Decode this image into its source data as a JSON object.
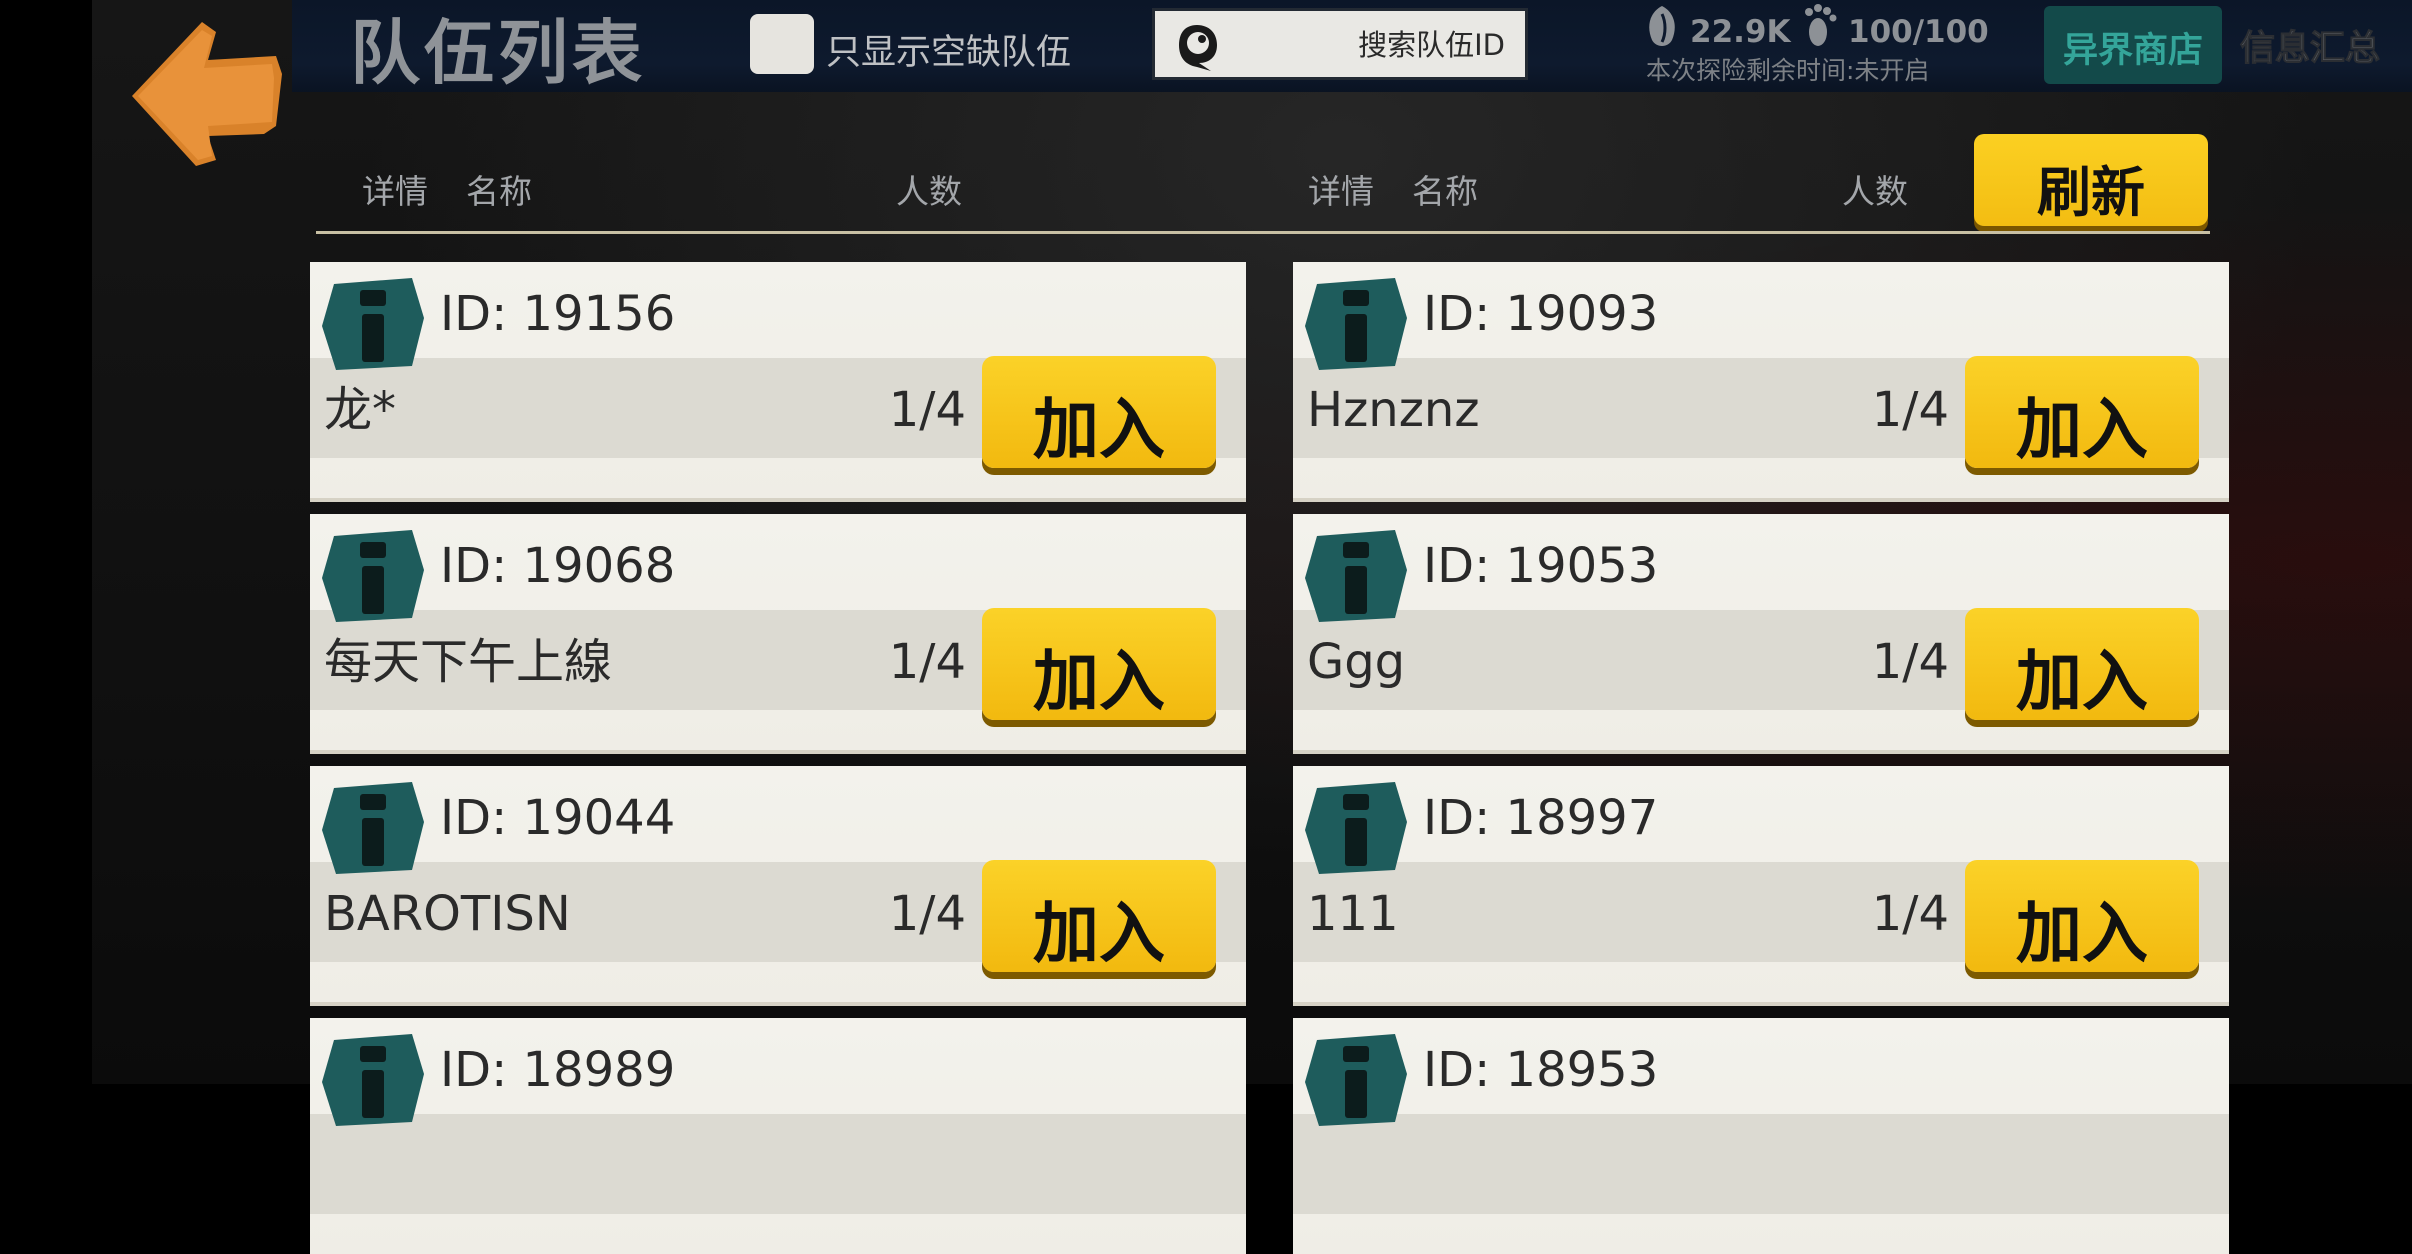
{
  "header": {
    "title": "队伍列表",
    "empty_only_label": "只显示空缺队伍",
    "search_placeholder": "搜索队伍ID",
    "coins": "22.9K",
    "stamina": "100/100",
    "timer": "本次探险剩余时间:未开启",
    "shop_label": "异界商店",
    "info_label": "信息汇总"
  },
  "columns": {
    "left": {
      "details": "详情",
      "name": "名称",
      "count": "人数"
    },
    "right": {
      "details": "详情",
      "name": "名称",
      "count": "人数"
    },
    "refresh_label": "刷新"
  },
  "join_label": "加入",
  "teams": [
    {
      "id": "ID:  19156",
      "name": "龙*",
      "count": "1/4"
    },
    {
      "id": "ID:  19093",
      "name": "Hznznz",
      "count": "1/4"
    },
    {
      "id": "ID:  19068",
      "name": "每天下午上線",
      "count": "1/4"
    },
    {
      "id": "ID:  19053",
      "name": "Ggg",
      "count": "1/4"
    },
    {
      "id": "ID:  19044",
      "name": "BAROTISN",
      "count": "1/4"
    },
    {
      "id": "ID:  18997",
      "name": "111",
      "count": "1/4"
    },
    {
      "id": "ID:  18989",
      "name": "",
      "count": ""
    },
    {
      "id": "ID:  18953",
      "name": "",
      "count": ""
    }
  ],
  "colors": {
    "accent_yellow": "#f7c41a",
    "teal": "#1e5c5c",
    "back_orange": "#e08a2c",
    "topbar": "#0e1a2e"
  },
  "icons": {
    "back": "back-arrow-icon",
    "search": "search-icon",
    "coins": "seed-icon",
    "stamina": "footprint-icon",
    "details": "info-icon"
  }
}
